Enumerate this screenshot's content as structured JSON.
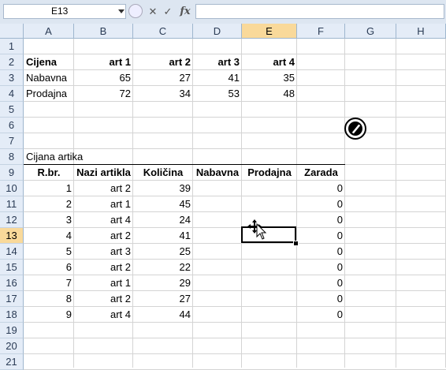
{
  "formula_bar": {
    "name_box": "E13",
    "cancel_icon": "✕",
    "enter_icon": "✓",
    "fx_label": "fx",
    "formula": ""
  },
  "columns": [
    "A",
    "B",
    "C",
    "D",
    "E",
    "F",
    "G",
    "H"
  ],
  "selected_column": "E",
  "rows": [
    "1",
    "2",
    "3",
    "4",
    "5",
    "6",
    "7",
    "8",
    "9",
    "10",
    "11",
    "12",
    "13",
    "14",
    "15",
    "16",
    "17",
    "18",
    "19",
    "20",
    "21"
  ],
  "selected_row": "13",
  "price_table": {
    "header": [
      "Cijena",
      "art 1",
      "art 2",
      "art 3",
      "art 4"
    ],
    "rows": [
      [
        "Nabavna",
        "65",
        "27",
        "41",
        "35"
      ],
      [
        "Prodajna",
        "72",
        "34",
        "53",
        "48"
      ]
    ]
  },
  "sales_table": {
    "title": "Cijana artika",
    "header": [
      "R.br.",
      "Nazi artikla",
      "Količina",
      "Nabavna",
      "Prodajna",
      "Zarada"
    ],
    "rows": [
      [
        "1",
        "art 2",
        "39",
        "",
        "",
        "0"
      ],
      [
        "2",
        "art 1",
        "45",
        "",
        "",
        "0"
      ],
      [
        "3",
        "art 4",
        "24",
        "",
        "",
        "0"
      ],
      [
        "4",
        "art 2",
        "41",
        "",
        "",
        "0"
      ],
      [
        "5",
        "art 3",
        "25",
        "",
        "",
        "0"
      ],
      [
        "6",
        "art 2",
        "22",
        "",
        "",
        "0"
      ],
      [
        "7",
        "art 1",
        "29",
        "",
        "",
        "0"
      ],
      [
        "8",
        "art 2",
        "27",
        "",
        "",
        "0"
      ],
      [
        "9",
        "art 4",
        "44",
        "",
        "",
        "0"
      ]
    ]
  },
  "active_cell": "E13"
}
